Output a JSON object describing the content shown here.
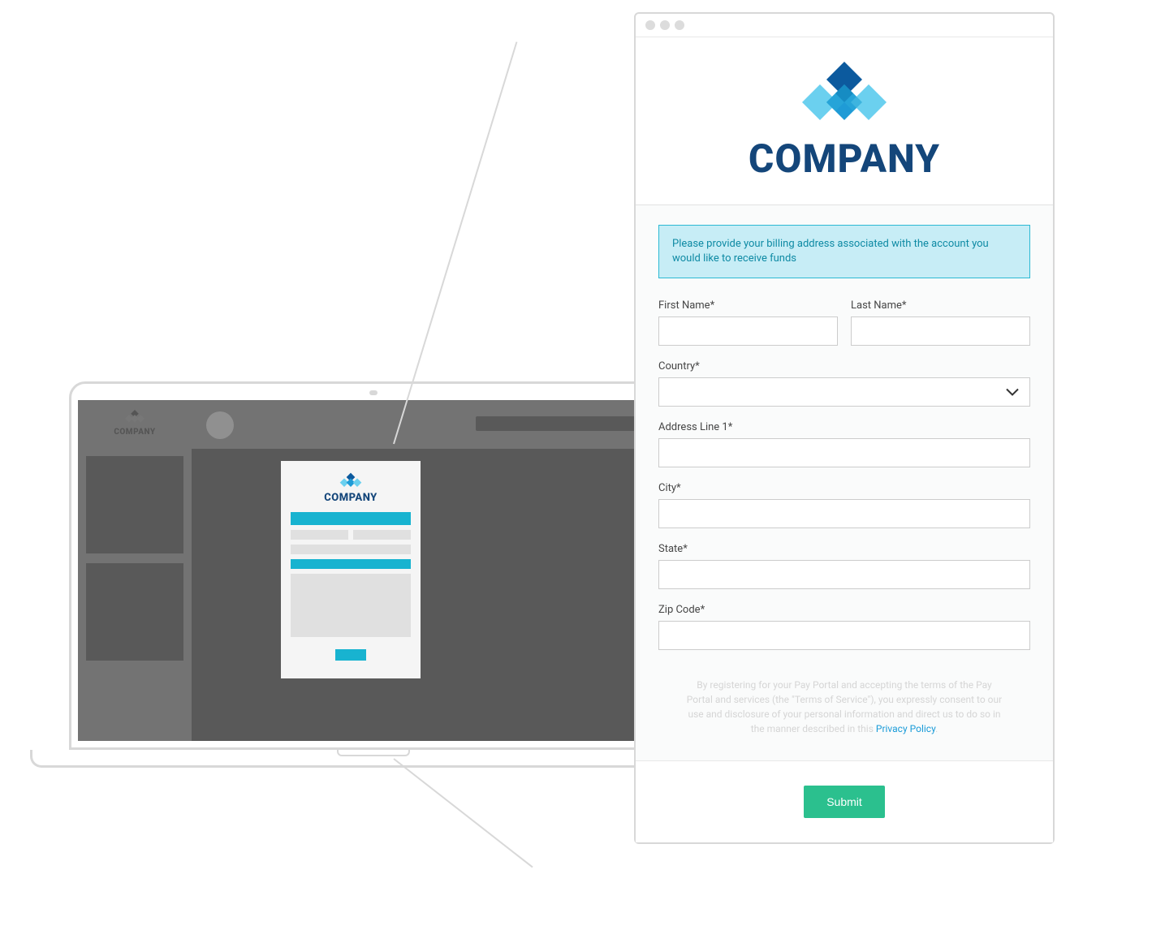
{
  "brand": {
    "name": "COMPANY",
    "colors": {
      "primary": "#14467a",
      "accent_blue_dark": "#0c5a9e",
      "accent_blue_mid": "#1f9bd6",
      "accent_blue_light": "#6bd0ef",
      "submit": "#2bc08e"
    }
  },
  "info_message": "Please provide your billing address associated with the account you would like to receive funds",
  "form": {
    "first_name": {
      "label": "First Name*",
      "value": ""
    },
    "last_name": {
      "label": "Last Name*",
      "value": ""
    },
    "country": {
      "label": "Country*",
      "value": ""
    },
    "address_line_1": {
      "label": "Address Line 1*",
      "value": ""
    },
    "city": {
      "label": "City*",
      "value": ""
    },
    "state": {
      "label": "State*",
      "value": ""
    },
    "zip_code": {
      "label": "Zip Code*",
      "value": ""
    }
  },
  "disclaimer": {
    "text": "By registering for your Pay Portal and accepting the terms of the Pay Portal and services (the \"Terms of Service\"), you expressly consent to our use and disclosure of your personal information and direct us to do so in the manner described in this ",
    "link_text": "Privacy Policy",
    "suffix": "."
  },
  "submit_label": "Submit"
}
